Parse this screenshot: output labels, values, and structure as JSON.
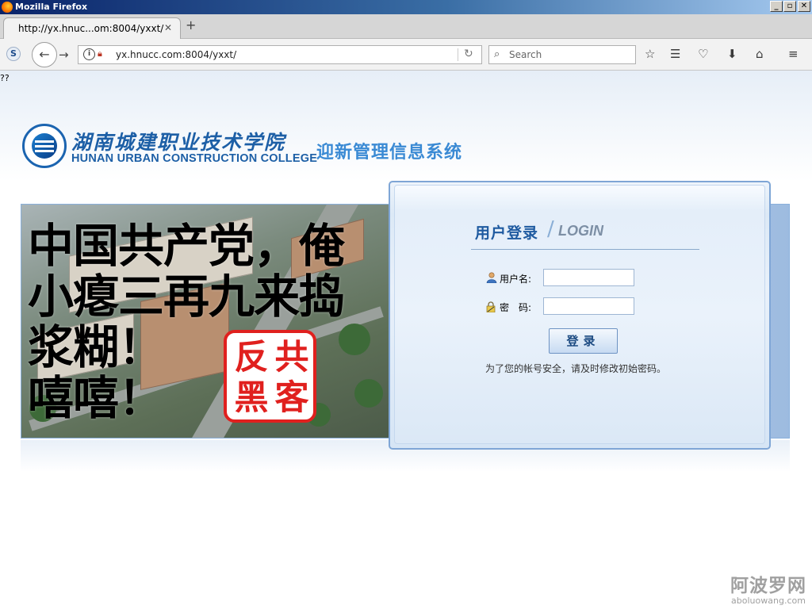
{
  "window": {
    "title": "Mozilla Firefox",
    "controls": {
      "minimize": "_",
      "maximize": "▫",
      "close": "✕"
    }
  },
  "tabs": [
    {
      "label": "http://yx.hnuc...om:8004/yxxt/",
      "close": "✕"
    }
  ],
  "new_tab": "+",
  "navbar": {
    "back": "←",
    "forward": "→",
    "url": "yx.hnucc.com:8004/yxxt/",
    "search_placeholder": "Search",
    "s_icon": "S",
    "icons": [
      "bookmark-star-icon",
      "reading-list-icon",
      "pocket-icon",
      "download-icon",
      "home-icon",
      "menu-icon"
    ]
  },
  "page": {
    "broken_chars": "??",
    "college_cn": "湖南城建职业技术学院",
    "college_en": "HUNAN URBAN CONSTRUCTION COLLEGE",
    "system_name": "迎新管理信息系统",
    "banner": {
      "graffiti": "中国共产党，俺\n小瘪三再九来捣\n浆糊！\n嘻嘻！",
      "seal_chars": [
        "反",
        "共",
        "黑",
        "客"
      ]
    },
    "login": {
      "title": "用户登录",
      "title_en": "LOGIN",
      "username_label": "用户名:",
      "username_value": "",
      "password_label": "密　码:",
      "password_value": "",
      "submit_label": "登录",
      "hint": "为了您的帐号安全，请及时修改初始密码。"
    },
    "watermark": {
      "cn": "阿波罗网",
      "en": "aboluowang.com"
    }
  },
  "colors": {
    "brand_blue": "#1d5fa6",
    "system_title": "#3a8ad4",
    "seal_red": "#e0201e",
    "panel_border": "#7fa6d6"
  }
}
